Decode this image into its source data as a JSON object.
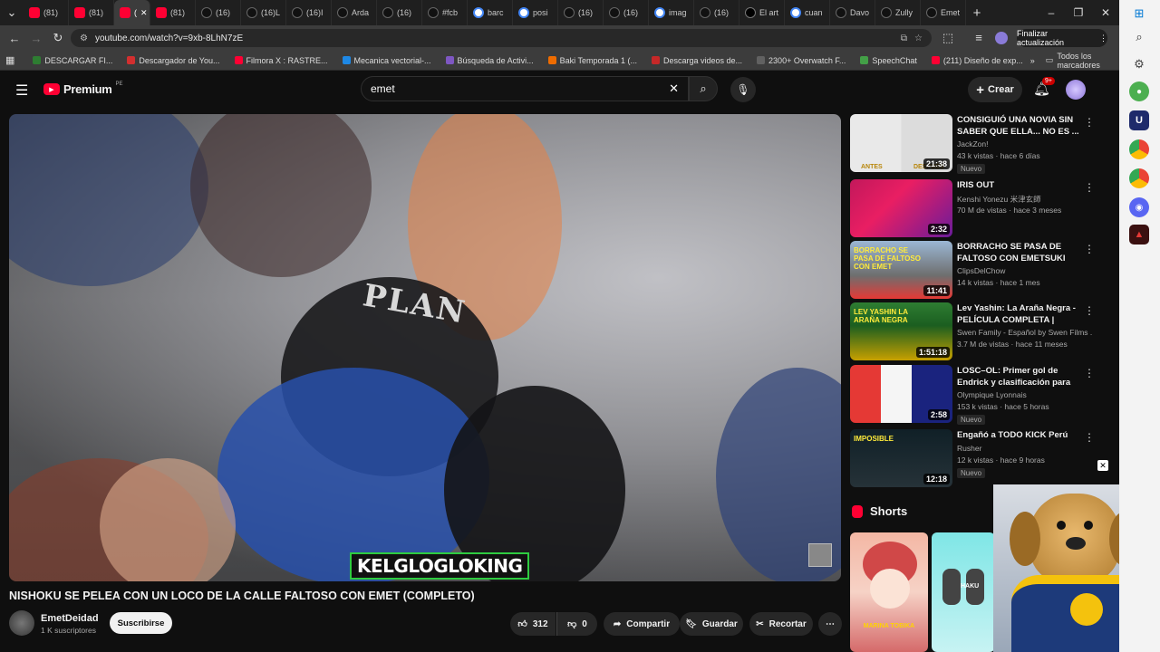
{
  "browser": {
    "tabs": [
      {
        "icon": "youtube-icon",
        "label": "(81)"
      },
      {
        "icon": "youtube-icon",
        "label": "(81)"
      },
      {
        "icon": "youtube-icon",
        "label": "(",
        "active": true
      },
      {
        "icon": "youtube-icon",
        "label": "(81)"
      },
      {
        "icon": "tiktok-icon",
        "label": "(16)"
      },
      {
        "icon": "tiktok-icon",
        "label": "(16)L"
      },
      {
        "icon": "tiktok-icon",
        "label": "(16)I"
      },
      {
        "icon": "tiktok-icon",
        "label": "Arda"
      },
      {
        "icon": "tiktok-icon",
        "label": "(16)"
      },
      {
        "icon": "tiktok-icon",
        "label": "#fcb"
      },
      {
        "icon": "google-icon",
        "label": "barc"
      },
      {
        "icon": "google-icon",
        "label": "posi"
      },
      {
        "icon": "tiktok-icon",
        "label": "(16)"
      },
      {
        "icon": "tiktok-icon",
        "label": "(16)"
      },
      {
        "icon": "google-icon",
        "label": "imag"
      },
      {
        "icon": "tiktok-icon",
        "label": "(16)"
      },
      {
        "icon": "x-icon",
        "label": "El art"
      },
      {
        "icon": "google-icon",
        "label": "cuan"
      },
      {
        "icon": "tiktok-icon",
        "label": "Davo"
      },
      {
        "icon": "tiktok-icon",
        "label": "Zully"
      },
      {
        "icon": "tiktok-icon",
        "label": "Emet"
      }
    ],
    "new_tab": "+",
    "url": "youtube.com/watch?v=9xb-8LhN7zE",
    "update_button": "Finalizar actualización",
    "bookmarks": [
      {
        "label": "DESCARGAR FI...",
        "color": "#2e7d32"
      },
      {
        "label": "Descargador de You...",
        "color": "#d32f2f"
      },
      {
        "label": "Filmora X : RASTRE...",
        "color": "#ff0033"
      },
      {
        "label": "Mecanica vectorial-...",
        "color": "#1e88e5"
      },
      {
        "label": "Búsqueda de Activi...",
        "color": "#7e57c2"
      },
      {
        "label": "Baki Temporada 1 (...",
        "color": "#ef6c00"
      },
      {
        "label": "Descarga videos de...",
        "color": "#c62828"
      },
      {
        "label": "2300+ Overwatch F...",
        "color": "#616161"
      },
      {
        "label": "SpeechChat",
        "color": "#43a047"
      },
      {
        "label": "(211) Diseño de exp...",
        "color": "#ff0033"
      }
    ],
    "all_bookmarks": "Todos los marcadores"
  },
  "youtube": {
    "logo_text": "Premium",
    "region": "PE",
    "search_value": "emet",
    "create_label": "Crear",
    "notif_count": "9+",
    "video": {
      "title": "NISHOKU SE PELEA CON UN LOCO DE LA CALLE FALTOSO CON EMET (COMPLETO)",
      "overlay_text": "KELGLOGLOKING",
      "shirt_text": "PLAN"
    },
    "channel": {
      "name": "EmetDeidad",
      "subs": "1 K suscriptores",
      "subscribe": "Suscribirse"
    },
    "actions": {
      "likes": "312",
      "dislikes": "0",
      "share": "Compartir",
      "save": "Guardar",
      "clip": "Recortar"
    },
    "recommendations": [
      {
        "title": "CONSIGUIÓ UNA NOVIA SIN SABER QUE ELLA... NO ES ...",
        "channel": "JackZon!",
        "meta": "43 k vistas · hace 6 días",
        "duration": "21:38",
        "badge": "Nuevo",
        "thumb_left": "ANTES",
        "thumb_right": "DESPUÉS"
      },
      {
        "title": "IRIS OUT",
        "channel": "Kenshi Yonezu 米津玄師",
        "meta": "70 M de vistas · hace 3 meses",
        "duration": "2:32",
        "badge": ""
      },
      {
        "title": "BORRACHO SE PASA DE FALTOSO CON EMETSUKI",
        "channel": "ClipsDelChow",
        "meta": "14 k vistas · hace 1 mes",
        "duration": "11:41",
        "badge": "",
        "thumb_text": "BORRACHO SE PASA DE FALTOSO CON EMET"
      },
      {
        "title": "Lev Yashin: La Araña Negra - PELÍCULA COMPLETA | Basad...",
        "channel": "Swen Family - Español  by Swen Films ...",
        "meta": "3.7 M de vistas · hace 11 meses",
        "duration": "1:51:18",
        "badge": "",
        "thumb_text": "LEV YASHIN LA ARAÑA NEGRA"
      },
      {
        "title": "LOSC–OL: Primer gol de Endrick y clasificación para los octavo...",
        "channel": "Olympique Lyonnais",
        "meta": "153 k vistas · hace 5 horas",
        "duration": "2:58",
        "badge": "Nuevo"
      },
      {
        "title": "Engañó a TODO KICK Perú",
        "channel": "Rusher",
        "meta": "12 k vistas · hace 9 horas",
        "duration": "12:18",
        "badge": "Nuevo",
        "thumb_text": "IMPOSIBLE"
      }
    ],
    "shorts_label": "Shorts",
    "short1_caption": "MARINA TOBIKA",
    "short2_caption": "HAKU"
  },
  "colors": {
    "yt_red": "#ff0033",
    "bg": "#0f0f0f",
    "accent_blue": "#3ea6ff"
  }
}
